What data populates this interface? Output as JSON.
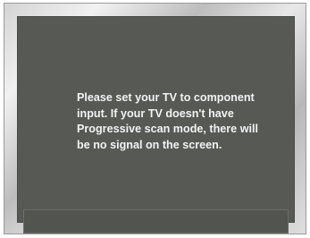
{
  "screen": {
    "message": "Please set your TV to component\ninput. If your TV doesn't have\nProgressive scan mode, there will\nbe no signal on the screen.",
    "status_text": ""
  },
  "colors": {
    "screen_background": "#575955",
    "text": "#f2f2f2",
    "bezel": "#d8d8d8"
  }
}
